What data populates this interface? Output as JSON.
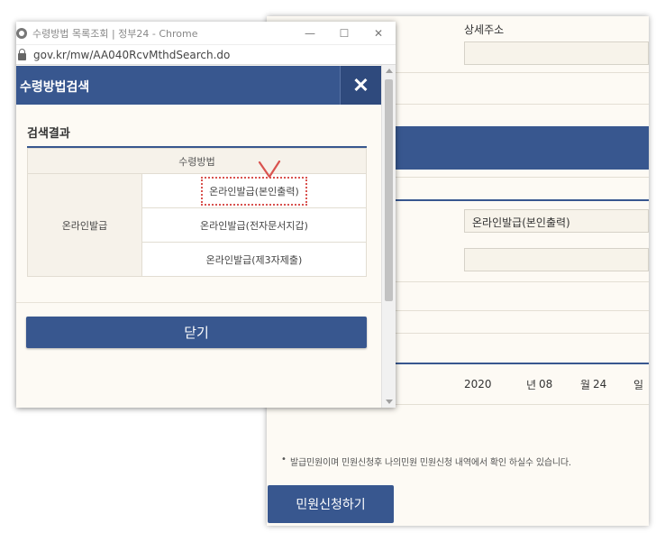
{
  "background_page": {
    "detail_address_label": "상세주소",
    "receipt_method_value": "온라인발급(본인출력)",
    "date": {
      "year": "2020",
      "year_unit": "년",
      "month": "08",
      "month_unit": "월",
      "day": "24",
      "day_unit": "일"
    },
    "notice": "발급민원이며 민원신청후 나의민원 민원신청 내역에서 확인 하실수 있습니다.",
    "submit_label": "민원신청하기"
  },
  "popup": {
    "window_title": "수령방법 목록조회 | 정부24 - Chrome",
    "window_controls": {
      "minimize": "—",
      "maximize": "☐",
      "close": "✕"
    },
    "url": "gov.kr/mw/AA040RcvMthdSearch.do",
    "header_title": "수령방법검색",
    "close_icon": "✕",
    "section_title": "검색결과",
    "table": {
      "column_header": "수령방법",
      "group_label": "온라인발급",
      "rows": [
        "온라인발급(본인출력)",
        "온라인발급(전자문서지갑)",
        "온라인발급(제3자제출)"
      ]
    },
    "close_button_label": "닫기"
  },
  "colors": {
    "accent": "#38578f",
    "highlight": "#d9534f",
    "background": "#fdfaf4"
  }
}
